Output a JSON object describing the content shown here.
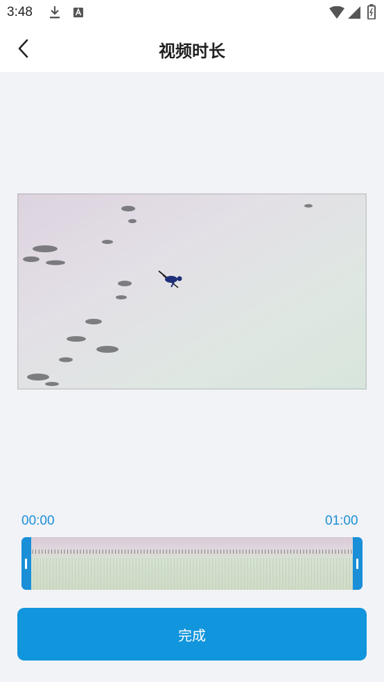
{
  "status_bar": {
    "time": "3:48",
    "left_icons": [
      "download-icon",
      "text-a-icon"
    ],
    "right_icons": [
      "wifi-icon",
      "signal-icon",
      "battery-icon"
    ]
  },
  "header": {
    "title": "视频时长",
    "back_icon": "chevron-left-icon"
  },
  "video": {
    "thumbnail": "skier-on-snow-slope"
  },
  "trim": {
    "start_time": "00:00",
    "end_time": "01:00"
  },
  "actions": {
    "done_label": "完成"
  },
  "colors": {
    "accent": "#1a8fd8",
    "button": "#1195dc",
    "background": "#f2f3f7"
  }
}
